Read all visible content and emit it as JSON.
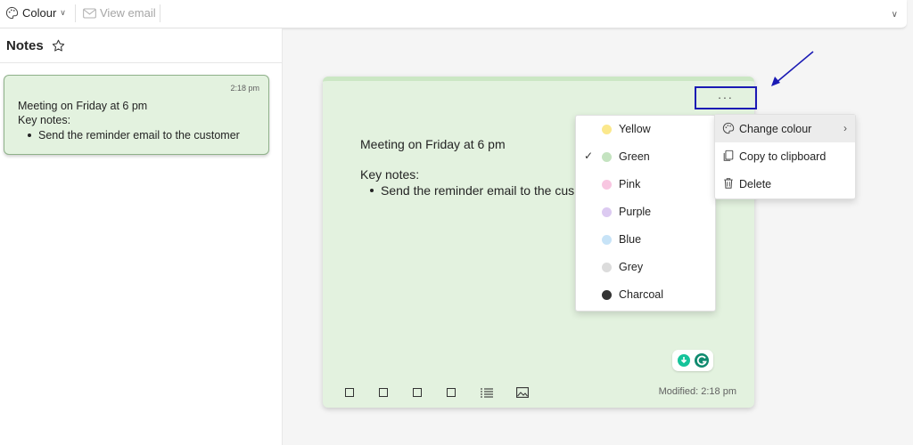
{
  "toolbar": {
    "colour_label": "Colour",
    "view_email_label": "View email"
  },
  "notes_panel": {
    "title": "Notes",
    "note": {
      "time": "2:18 pm",
      "line1": "Meeting on Friday at 6 pm",
      "line2": "Key notes:",
      "bullet1": "Send the reminder email to the customer"
    }
  },
  "editor": {
    "line1": "Meeting on Friday at 6 pm",
    "line2": "Key notes:",
    "bullet1": "Send the reminder email to the cus",
    "more_label": "...",
    "modified": "Modified: 2:18 pm"
  },
  "colour_menu": {
    "items": [
      {
        "label": "Yellow",
        "color": "#fbe88c"
      },
      {
        "label": "Green",
        "color": "#c4e3c0",
        "checked": true
      },
      {
        "label": "Pink",
        "color": "#f8c6e1"
      },
      {
        "label": "Purple",
        "color": "#dccaf1"
      },
      {
        "label": "Blue",
        "color": "#c7e3f7"
      },
      {
        "label": "Grey",
        "color": "#dcdcdc"
      },
      {
        "label": "Charcoal",
        "color": "#333333"
      }
    ]
  },
  "context_menu": {
    "items": [
      {
        "label": "Change colour"
      },
      {
        "label": "Copy to clipboard"
      },
      {
        "label": "Delete"
      }
    ]
  },
  "colors": {
    "note_bg": "#e3f2df",
    "annotation": "#1a1ab4"
  }
}
